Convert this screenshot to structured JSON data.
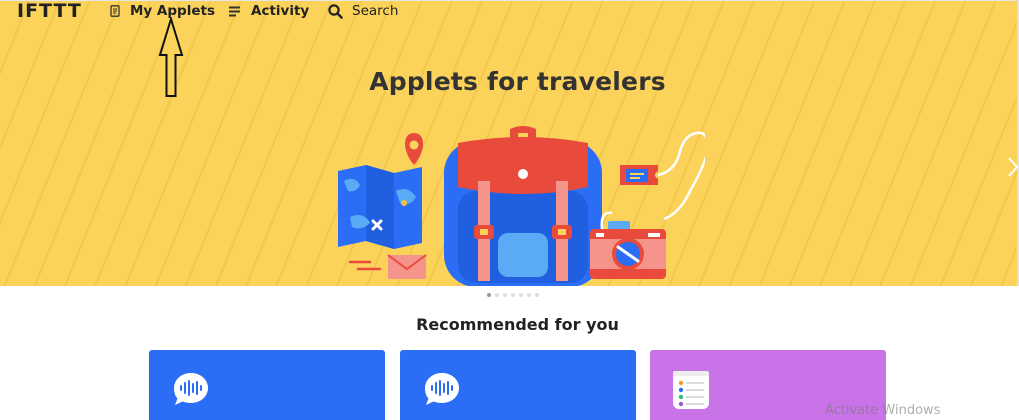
{
  "nav": {
    "logo": "IFTTT",
    "my_applets_label": "My Applets",
    "activity_label": "Activity",
    "search_label": "Search",
    "icons": {
      "my_applets": "document-icon",
      "activity": "list-icon",
      "search": "search-icon"
    }
  },
  "hero": {
    "title": "Applets for travelers",
    "background_color": "#fcd35a",
    "carousel": {
      "total_slides": 7,
      "active_index": 0
    }
  },
  "recommended": {
    "title": "Recommended for you",
    "cards": [
      {
        "color": "#2b6ef5",
        "icon": "speech-bubble-waveform-icon"
      },
      {
        "color": "#2b6ef5",
        "icon": "speech-bubble-waveform-icon"
      },
      {
        "color": "#c873e8",
        "icon": "notes-list-icon"
      }
    ]
  },
  "os_watermark": "Activate Windows",
  "colors": {
    "text_dark": "#333333",
    "card_blue": "#2b6ef5",
    "card_purple": "#c873e8"
  }
}
